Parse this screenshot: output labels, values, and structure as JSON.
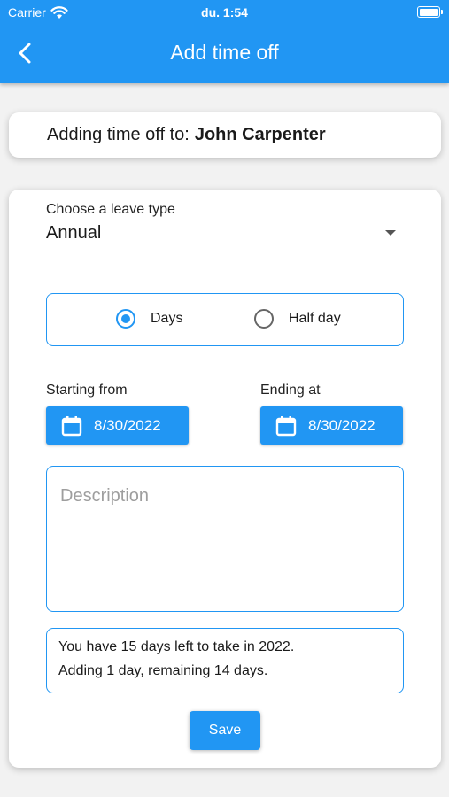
{
  "status_bar": {
    "carrier": "Carrier",
    "time": "du. 1:54"
  },
  "app_bar": {
    "title": "Add time off",
    "back_icon": "chevron-left-icon",
    "background": "#2196f3"
  },
  "employee": {
    "prefix": "Adding time off to:",
    "name": "John Carpenter"
  },
  "form": {
    "leave_type": {
      "label": "Choose a leave type",
      "value": "Annual"
    },
    "duration": {
      "options": [
        {
          "label": "Days",
          "selected": true
        },
        {
          "label": "Half day",
          "selected": false
        }
      ]
    },
    "start": {
      "label": "Starting from",
      "date": "8/30/2022"
    },
    "end": {
      "label": "Ending at",
      "date": "8/30/2022"
    },
    "description": {
      "placeholder": "Description",
      "value": ""
    },
    "balance": {
      "line1": "You have 15 days left to take in 2022.",
      "line2": "Adding 1 day, remaining 14 days."
    },
    "save_label": "Save"
  }
}
